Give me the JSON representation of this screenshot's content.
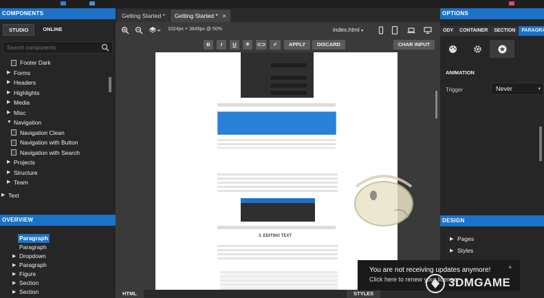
{
  "colors": {
    "accent": "#1a73c9",
    "panel": "#262626",
    "workspace": "#3a3a3a"
  },
  "left_panel": {
    "title": "COMPONENTS",
    "tabs": [
      "STUDIO",
      "ONLINE"
    ],
    "search_placeholder": "Search components",
    "tree": [
      {
        "label": "Footer Dark",
        "kind": "doc"
      },
      {
        "label": "Forms",
        "kind": "collapsed"
      },
      {
        "label": "Headers",
        "kind": "collapsed"
      },
      {
        "label": "Highlights",
        "kind": "collapsed"
      },
      {
        "label": "Media",
        "kind": "collapsed"
      },
      {
        "label": "Misc",
        "kind": "collapsed"
      },
      {
        "label": "Navigation",
        "kind": "expanded"
      },
      {
        "label": "Navigation Clean",
        "kind": "doc"
      },
      {
        "label": "Navigation with Button",
        "kind": "doc"
      },
      {
        "label": "Navigation with Search",
        "kind": "doc"
      },
      {
        "label": "Projects",
        "kind": "collapsed"
      },
      {
        "label": "Structure",
        "kind": "collapsed"
      },
      {
        "label": "Team",
        "kind": "collapsed"
      },
      {
        "label": "Text",
        "kind": "collapsed-top"
      }
    ]
  },
  "overview": {
    "title": "OVERVIEW",
    "items": [
      {
        "label": "Paragraph",
        "selected": true,
        "arrow": false
      },
      {
        "label": "Paragraph",
        "selected": false,
        "arrow": false
      },
      {
        "label": "Dropdown",
        "selected": false,
        "arrow": true
      },
      {
        "label": "Paragraph",
        "selected": false,
        "arrow": true
      },
      {
        "label": "Figure",
        "selected": false,
        "arrow": true
      },
      {
        "label": "Section",
        "selected": false,
        "arrow": true
      },
      {
        "label": "Section",
        "selected": false,
        "arrow": true
      }
    ]
  },
  "doc_tabs": [
    {
      "label": "Getting Started *",
      "active": false
    },
    {
      "label": "Getting Started *",
      "active": true
    }
  ],
  "toolbar": {
    "dimensions": "1024px × 3849px @ 50%",
    "file": "index.html"
  },
  "format_bar": {
    "bold": "B",
    "italic": "I",
    "underline": "U",
    "strike": "T",
    "apply": "APPLY",
    "discard": "DISCARD",
    "char_input": "CHAR INPUT"
  },
  "page": {
    "heading": "3. EDITING TEXT"
  },
  "bottom_tabs": {
    "html": "HTML",
    "styles": "STYLES"
  },
  "right_panel": {
    "title": "OPTIONS",
    "tabs": [
      "ODY",
      "CONTAINER",
      "SECTION",
      "PARAGRA"
    ],
    "sub_head": "ANIMATION",
    "trigger_label": "Trigger",
    "trigger_value": "Never",
    "design_title": "DESIGN",
    "design_items": [
      "Pages",
      "Styles"
    ]
  },
  "toast": {
    "line1": "You are not receiving updates anymore!",
    "line2": "Click here to renew your license.",
    "close": "×"
  },
  "watermark": "3DMGAME"
}
